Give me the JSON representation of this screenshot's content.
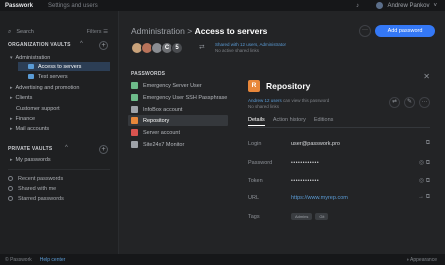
{
  "topbar": {
    "brand": "Passwork",
    "links": "Settings and users",
    "bell": "♪",
    "user": "Andrew Pankov",
    "chevron": "˅"
  },
  "sidebar": {
    "search_placeholder": "Search",
    "search_icon": "⌕",
    "filters": "Filters ☰",
    "org_label": "ORGANIZATION VAULTS",
    "add_icon": "+",
    "tree": [
      {
        "label": "Administration",
        "caret": "▾"
      },
      {
        "label": "Access to servers"
      },
      {
        "label": "Test servers"
      },
      {
        "label": "Advertising and promotion",
        "caret": "▸"
      },
      {
        "label": "Clients",
        "caret": "▸"
      },
      {
        "label": "Customer support",
        "caret": ""
      },
      {
        "label": "Finance",
        "caret": "▸"
      },
      {
        "label": "Mail accounts",
        "caret": "▸"
      }
    ],
    "private_label": "PRIVATE VAULTS",
    "private_items": [
      {
        "label": "My passwords",
        "caret": "▸"
      }
    ],
    "links": [
      "Recent passwords",
      "Shared with me",
      "Starred passwords"
    ]
  },
  "main": {
    "breadcrumb_parent": "Administration",
    "breadcrumb_sep": ">",
    "breadcrumb_current": "Access to servers",
    "more": "···",
    "add_password": "Add password",
    "avatars": [
      {
        "letter": "",
        "color": "#c9a27a"
      },
      {
        "letter": "",
        "color": "#b9735a"
      },
      {
        "letter": "",
        "color": "#8a8d92"
      },
      {
        "letter": "C",
        "color": "#6d6f73"
      },
      {
        "letter": "5",
        "color": "#4a4c50"
      }
    ],
    "share_icon": "⮂",
    "shared_line1": "Shared with 12 users, Administrator",
    "shared_line2": "No active shared links",
    "passwords_label": "PASSWORDS",
    "passwords": [
      {
        "label": "Emergency Server User",
        "color": "#6dbb8a"
      },
      {
        "label": "Emergency User SSH Passphrase",
        "color": "#6dbb8a"
      },
      {
        "label": "InfoBox account",
        "color": "#9ea2a8"
      },
      {
        "label": "Repository",
        "color": "#e8873a"
      },
      {
        "label": "Server account",
        "color": "#d9534f"
      },
      {
        "label": "Site24x7 Monitor",
        "color": "#9ea2a8"
      }
    ]
  },
  "detail": {
    "icon_letter": "R",
    "title": "Repository",
    "close": "✕",
    "sub_blue": "Andrew 12 users",
    "sub_text": " can view this password",
    "sub_line2": "No shared links",
    "actions": [
      "⮂",
      "✎",
      "···"
    ],
    "tabs": [
      "Details",
      "Action history",
      "Editions"
    ],
    "fields": [
      {
        "label": "Login",
        "value": "user@passwork.pro",
        "icons": "⧉"
      },
      {
        "label": "Password",
        "value": "••••••••••••",
        "icons": "◎ ⧉"
      },
      {
        "label": "Token",
        "value": "••••••••••••",
        "icons": "◎ ⧉"
      },
      {
        "label": "URL",
        "value": "https://www.myrep.com",
        "icons": "→ ⧉"
      },
      {
        "label": "Tags",
        "tags": [
          "Admins",
          "Git"
        ]
      }
    ]
  },
  "footer": {
    "copyright": "© Passwork",
    "help": "Help center",
    "appearance": "◑ Appearance"
  }
}
